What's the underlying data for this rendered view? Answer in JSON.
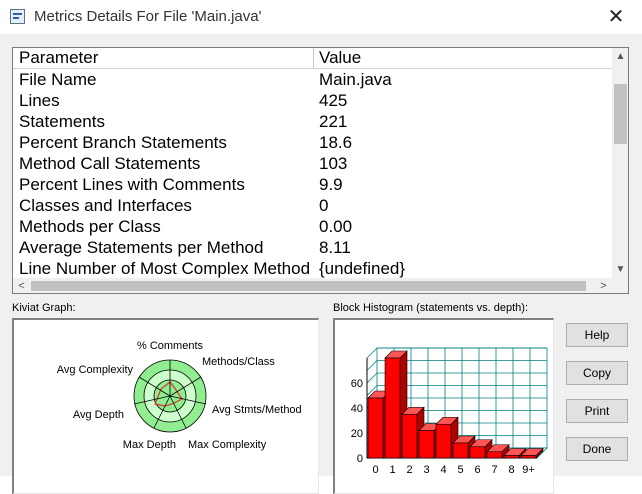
{
  "window": {
    "title": "Metrics Details For File 'Main.java'",
    "close_glyph": "✕",
    "icon": "document-chart-icon"
  },
  "table": {
    "headers": {
      "parameter": "Parameter",
      "value": "Value"
    },
    "rows": [
      {
        "parameter": "File Name",
        "value": "Main.java"
      },
      {
        "parameter": "Lines",
        "value": "425"
      },
      {
        "parameter": "Statements",
        "value": "221"
      },
      {
        "parameter": "Percent Branch Statements",
        "value": "18.6"
      },
      {
        "parameter": "Method Call Statements",
        "value": "103"
      },
      {
        "parameter": "Percent Lines with Comments",
        "value": "9.9"
      },
      {
        "parameter": "Classes and Interfaces",
        "value": "0"
      },
      {
        "parameter": "Methods per Class",
        "value": "0.00"
      },
      {
        "parameter": "Average Statements per Method",
        "value": "8.11"
      },
      {
        "parameter": "Line Number of Most Complex Method",
        "value": "{undefined}"
      }
    ],
    "scroll_glyphs": {
      "up": "▲",
      "down": "▼",
      "left": "<",
      "right": ">"
    }
  },
  "kiviat": {
    "label": "Kiviat Graph:",
    "axes": [
      "% Comments",
      "Methods/Class",
      "Avg Stmts/Method",
      "Max Complexity",
      "Max Depth",
      "Avg Depth",
      "Avg Complexity"
    ],
    "colors": {
      "outer_ring": "#90ee90",
      "middle_ring": "#ccffcc",
      "inner_ring": "#90ee90",
      "plot": "#dd3333",
      "axis": "#000000"
    }
  },
  "histogram": {
    "label": "Block Histogram (statements vs. depth):",
    "bar_color": "#ff0000",
    "grid_color": "#008080"
  },
  "chart_data": {
    "type": "bar",
    "title": "Block Histogram (statements vs. depth):",
    "categories": [
      "0",
      "1",
      "2",
      "3",
      "4",
      "5",
      "6",
      "7",
      "8",
      "9+"
    ],
    "values": [
      48,
      80,
      35,
      22,
      27,
      12,
      9,
      5,
      2,
      2
    ],
    "yticks": [
      "0",
      "20",
      "40",
      "60"
    ],
    "ylim": [
      0,
      80
    ],
    "grid": true
  },
  "buttons": {
    "help": "Help",
    "copy": "Copy",
    "print": "Print",
    "done": "Done"
  }
}
